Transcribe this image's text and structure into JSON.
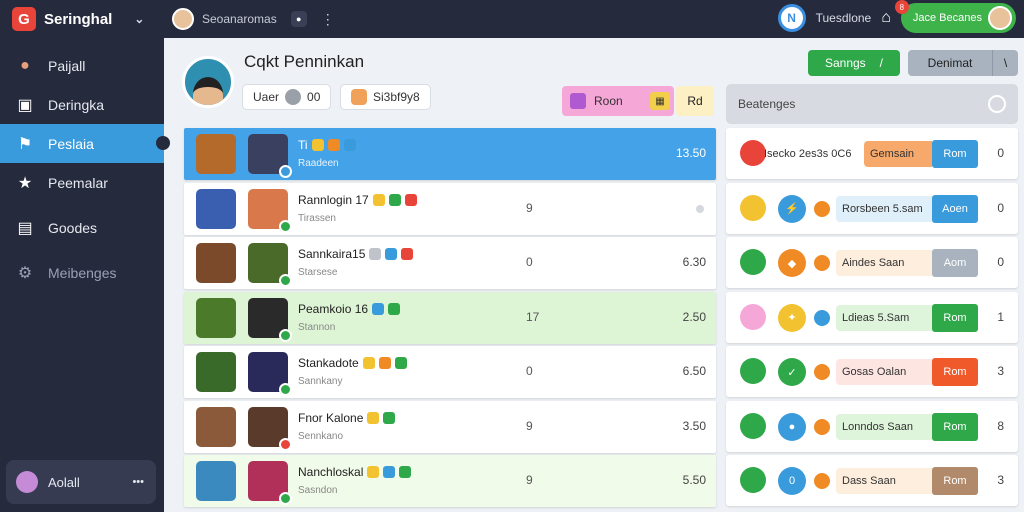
{
  "app": {
    "title": "Seringhal",
    "logo_glyph": "G"
  },
  "topbar": {
    "user_label": "Seoanaromas",
    "notif_letter": "N",
    "title": "Tuesdlone",
    "pill_label": "Jace Becanes",
    "pill_badge": "8"
  },
  "sidebar": {
    "items": [
      {
        "label": "Paijall",
        "icon": "avatar-icon",
        "glyph": "●"
      },
      {
        "label": "Deringka",
        "icon": "dashboard-icon",
        "glyph": "▣"
      },
      {
        "label": "Peslaia",
        "icon": "flag-icon",
        "glyph": "⚑"
      },
      {
        "label": "Peemalar",
        "icon": "star-icon",
        "glyph": "★"
      },
      {
        "label": "Goodes",
        "icon": "clipboard-icon",
        "glyph": "▤"
      },
      {
        "label": "Meibenges",
        "icon": "gear-icon",
        "glyph": "⚙"
      }
    ],
    "user": {
      "label": "Aolall",
      "more": "•••"
    }
  },
  "header": {
    "title": "Cqkt Penninkan",
    "chip1": {
      "label": "Uaer",
      "value": "00"
    },
    "chip2": {
      "label": "Si3bf9y8"
    },
    "tab_pink": "Roon",
    "tab_yellow": "Rd",
    "btn_green": {
      "label": "Sanngs",
      "suffix": "/"
    },
    "btn_gray": {
      "label": "Denimat",
      "suffix": "\\"
    }
  },
  "rows": [
    {
      "name": "Ti",
      "sub": "Raadeen",
      "mid": "",
      "val": "13.50",
      "style": "sel",
      "c1": "#b46a2a",
      "c2": "#3a4060",
      "badge": "#3a9bdc",
      "g": [
        "#f2c230",
        "#f08a24",
        "#3a9bdc"
      ]
    },
    {
      "name": "Rannlogin 17",
      "sub": "Tirassen",
      "mid": "9",
      "val": "",
      "style": "",
      "c1": "#3a5fb0",
      "c2": "#d9784a",
      "badge": "#2fa84a",
      "g": [
        "#f2c230",
        "#2fa84a",
        "#e8443a"
      ]
    },
    {
      "name": "Sannkaira15",
      "sub": "Starsese",
      "mid": "0",
      "val": "6.30",
      "style": "",
      "c1": "#7a4a2a",
      "c2": "#4a6a2a",
      "badge": "#2fa84a",
      "g": [
        "#c0c4ca",
        "#3a9bdc",
        "#e8443a"
      ]
    },
    {
      "name": "Peamkoio 16",
      "sub": "Stannon",
      "mid": "17",
      "val": "2.50",
      "style": "green",
      "c1": "#4a7a2a",
      "c2": "#2a2a2a",
      "badge": "#2fa84a",
      "g": [
        "#3a9bdc",
        "#2fa84a"
      ]
    },
    {
      "name": "Stankadote",
      "sub": "Sannkany",
      "mid": "0",
      "val": "6.50",
      "style": "",
      "c1": "#3a6a2a",
      "c2": "#2a2a5a",
      "badge": "#2fa84a",
      "g": [
        "#f2c230",
        "#f08a24",
        "#2fa84a"
      ]
    },
    {
      "name": "Fnor Kalone",
      "sub": "Sennkano",
      "mid": "9",
      "val": "3.50",
      "style": "",
      "c1": "#8a5a3a",
      "c2": "#5a3a2a",
      "badge": "#e8443a",
      "g": [
        "#f2c230",
        "#2fa84a"
      ]
    },
    {
      "name": "Nanchloskal",
      "sub": "Sasndon",
      "mid": "9",
      "val": "5.50",
      "style": "lightgreen",
      "c1": "#3a8ac0",
      "c2": "#b0305a",
      "badge": "#2fa84a",
      "g": [
        "#f2c230",
        "#3a9bdc",
        "#2fa84a"
      ]
    }
  ],
  "right_panel": {
    "search_label": "Beatenges",
    "rows": [
      {
        "c1": "#e8443a",
        "c2": "",
        "c2_glyph": "",
        "tag": "",
        "label": "Isecko 2es3s 0C6",
        "label_bg": "transparent",
        "chip": "Gemsain",
        "chip_bg": "#f6a96a",
        "btn": "Rom",
        "btn_bg": "#3a9bdc",
        "num": "0"
      },
      {
        "c1": "#f2c230",
        "c2": "#3a9bdc",
        "c2_glyph": "⚡",
        "tag": "#f08a24",
        "label": "Rorsbeen 5.sam",
        "label_bg": "#dff0fa",
        "chip": "",
        "chip_bg": "",
        "btn": "Aoen",
        "btn_bg": "#3a9bdc",
        "num": "0"
      },
      {
        "c1": "#2fa84a",
        "c2": "#f08a24",
        "c2_glyph": "◆",
        "tag": "#f08a24",
        "label": "Aindes  Saan",
        "label_bg": "#fdeedd",
        "chip": "",
        "chip_bg": "",
        "btn": "Aom",
        "btn_bg": "#a8b3bf",
        "num": "0"
      },
      {
        "c1": "#f5a7d8",
        "c2": "#f2c230",
        "c2_glyph": "✦",
        "tag": "#3a9bdc",
        "label": "Ldieas 5.Sam",
        "label_bg": "#def5dc",
        "chip": "",
        "chip_bg": "",
        "btn": "Rom",
        "btn_bg": "#2fa84a",
        "num": "1"
      },
      {
        "c1": "#2fa84a",
        "c2": "#2fa84a",
        "c2_glyph": "✓",
        "tag": "#f08a24",
        "label": "Gosas Oalan",
        "label_bg": "#fde6e1",
        "chip": "",
        "chip_bg": "",
        "btn": "Rom",
        "btn_bg": "#f05a2a",
        "num": "3"
      },
      {
        "c1": "#2fa84a",
        "c2": "#3a9bdc",
        "c2_glyph": "●",
        "tag": "#f08a24",
        "label": "Lonndos  Saan",
        "label_bg": "#def5dc",
        "chip": "",
        "chip_bg": "",
        "btn": "Rom",
        "btn_bg": "#2fa84a",
        "num": "8"
      },
      {
        "c1": "#2fa84a",
        "c2": "#3a9bdc",
        "c2_glyph": "0",
        "tag": "#f08a24",
        "label": "Dass  Saan",
        "label_bg": "#fdeedd",
        "chip": "",
        "chip_bg": "",
        "btn": "Rom",
        "btn_bg": "#b08a6a",
        "num": "3"
      }
    ]
  }
}
